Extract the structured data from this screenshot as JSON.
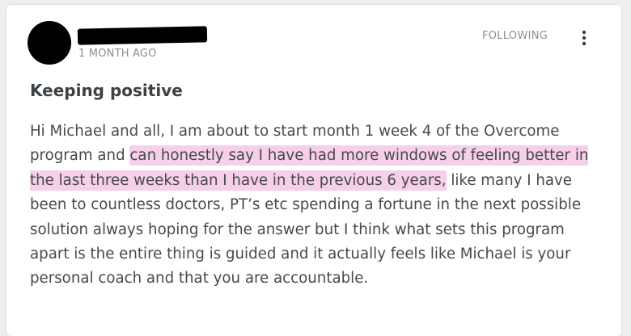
{
  "post": {
    "author_name": "redacted",
    "timestamp": "1 MONTH AGO",
    "follow_label": "FOLLOWING",
    "more_icon": "more-vertical-icon",
    "title": "Keeping positive",
    "body_before": "Hi Michael and all, I am about to start month 1 week 4 of the Overcome program and ",
    "body_highlight": "can honestly say I have had more windows of feeling better in the last three weeks than I have in the previous 6 years,",
    "body_after": " like many I have been to countless doctors, PT’s etc spending a fortune in the next possible solution always hoping for the answer but I think what sets this program apart is the entire thing is guided and it actually feels like Michael is your personal coach and that you are accountable.",
    "highlight_color": "#f6cfe9"
  }
}
